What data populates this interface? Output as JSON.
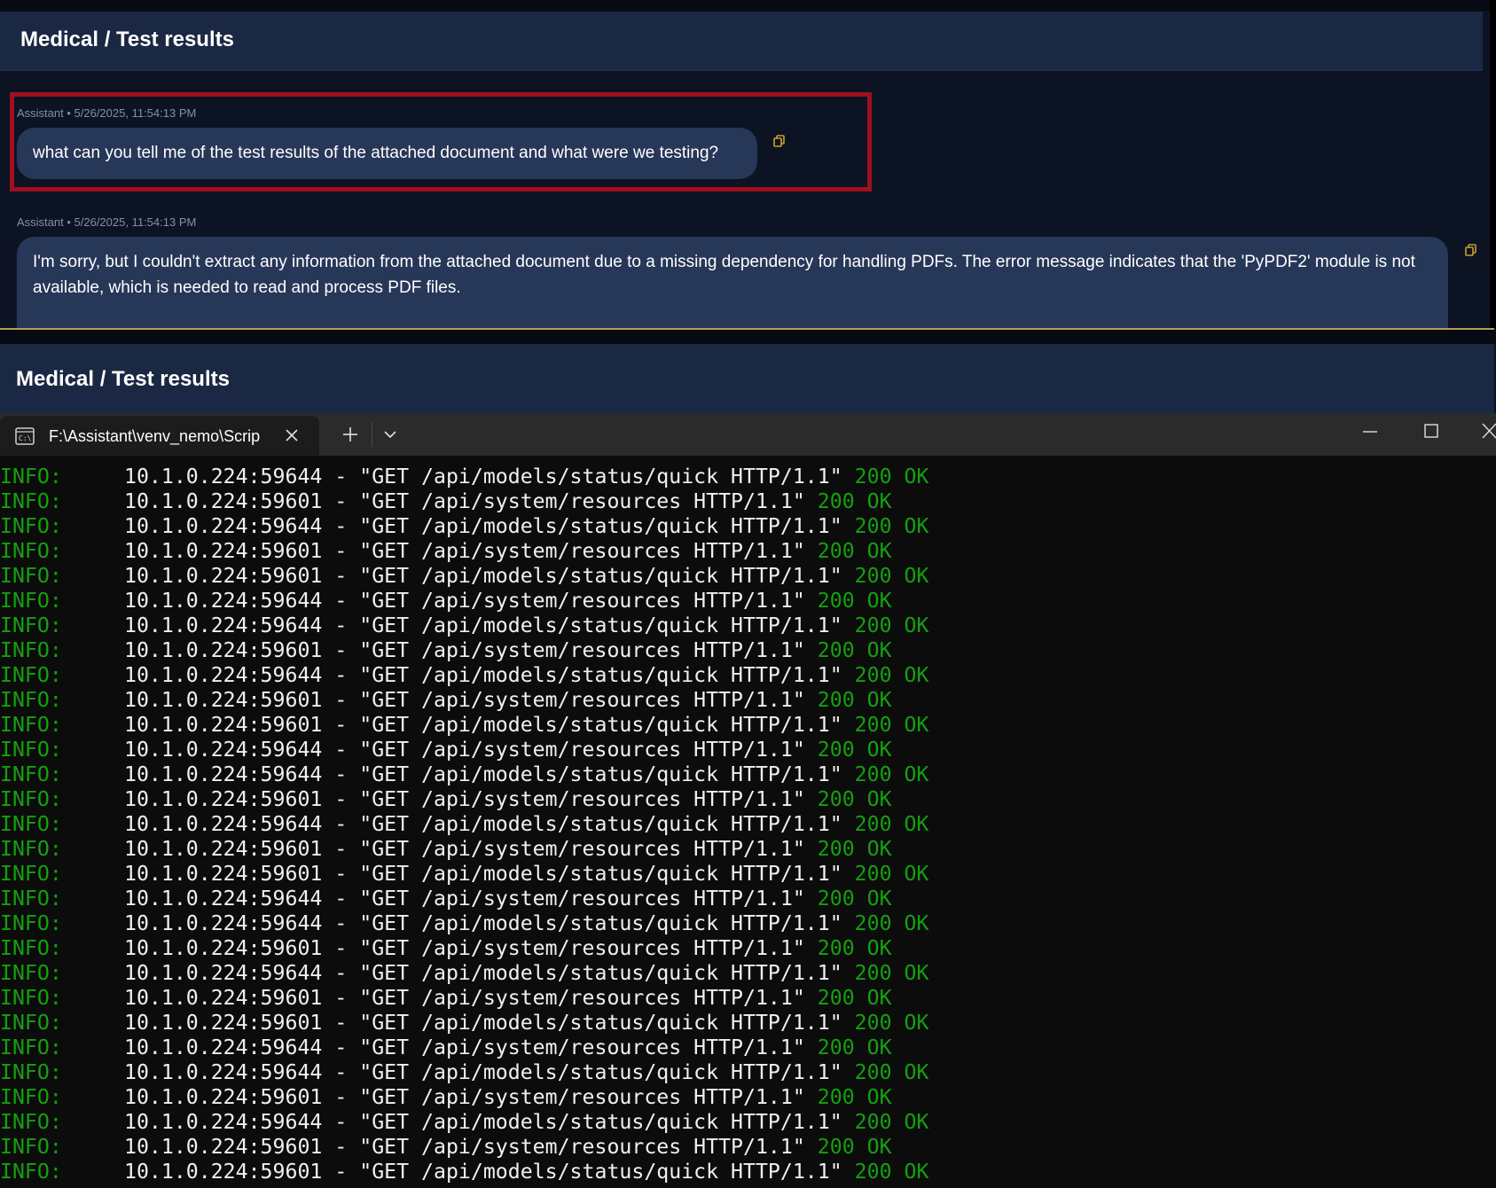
{
  "chat_top": {
    "header_title": "Medical / Test results",
    "messages": [
      {
        "meta": "Assistant • 5/26/2025, 11:54:13 PM",
        "text": "what can you tell me of the test results of the attached document and what were we testing?"
      },
      {
        "meta": "Assistant • 5/26/2025, 11:54:13 PM",
        "text": "I'm sorry, but I couldn't extract any information from the attached document due to a missing dependency for handling PDFs. The error message indicates that the 'PyPDF2' module is not available, which is needed to read and process PDF files."
      }
    ]
  },
  "chat_bottom": {
    "header_title": "Medical / Test results"
  },
  "terminal": {
    "tab_title": "F:\\Assistant\\venv_nemo\\Scrip",
    "icons": {
      "tab": "terminal-icon",
      "close": "close-icon",
      "new_tab": "plus-icon",
      "dropdown": "chevron-down-icon",
      "minimize": "minimize-icon",
      "maximize": "maximize-icon",
      "window_close": "close-icon"
    },
    "log_lines": [
      {
        "level": "INFO:",
        "text": "10.1.0.224:59644 - \"GET /api/models/status/quick HTTP/1.1\"",
        "status": "200 OK"
      },
      {
        "level": "INFO:",
        "text": "10.1.0.224:59601 - \"GET /api/system/resources HTTP/1.1\"",
        "status": "200 OK"
      },
      {
        "level": "INFO:",
        "text": "10.1.0.224:59644 - \"GET /api/models/status/quick HTTP/1.1\"",
        "status": "200 OK"
      },
      {
        "level": "INFO:",
        "text": "10.1.0.224:59601 - \"GET /api/system/resources HTTP/1.1\"",
        "status": "200 OK"
      },
      {
        "level": "INFO:",
        "text": "10.1.0.224:59601 - \"GET /api/models/status/quick HTTP/1.1\"",
        "status": "200 OK"
      },
      {
        "level": "INFO:",
        "text": "10.1.0.224:59644 - \"GET /api/system/resources HTTP/1.1\"",
        "status": "200 OK"
      },
      {
        "level": "INFO:",
        "text": "10.1.0.224:59644 - \"GET /api/models/status/quick HTTP/1.1\"",
        "status": "200 OK"
      },
      {
        "level": "INFO:",
        "text": "10.1.0.224:59601 - \"GET /api/system/resources HTTP/1.1\"",
        "status": "200 OK"
      },
      {
        "level": "INFO:",
        "text": "10.1.0.224:59644 - \"GET /api/models/status/quick HTTP/1.1\"",
        "status": "200 OK"
      },
      {
        "level": "INFO:",
        "text": "10.1.0.224:59601 - \"GET /api/system/resources HTTP/1.1\"",
        "status": "200 OK"
      },
      {
        "level": "INFO:",
        "text": "10.1.0.224:59601 - \"GET /api/models/status/quick HTTP/1.1\"",
        "status": "200 OK"
      },
      {
        "level": "INFO:",
        "text": "10.1.0.224:59644 - \"GET /api/system/resources HTTP/1.1\"",
        "status": "200 OK"
      },
      {
        "level": "INFO:",
        "text": "10.1.0.224:59644 - \"GET /api/models/status/quick HTTP/1.1\"",
        "status": "200 OK"
      },
      {
        "level": "INFO:",
        "text": "10.1.0.224:59601 - \"GET /api/system/resources HTTP/1.1\"",
        "status": "200 OK"
      },
      {
        "level": "INFO:",
        "text": "10.1.0.224:59644 - \"GET /api/models/status/quick HTTP/1.1\"",
        "status": "200 OK"
      },
      {
        "level": "INFO:",
        "text": "10.1.0.224:59601 - \"GET /api/system/resources HTTP/1.1\"",
        "status": "200 OK"
      },
      {
        "level": "INFO:",
        "text": "10.1.0.224:59601 - \"GET /api/models/status/quick HTTP/1.1\"",
        "status": "200 OK"
      },
      {
        "level": "INFO:",
        "text": "10.1.0.224:59644 - \"GET /api/system/resources HTTP/1.1\"",
        "status": "200 OK"
      },
      {
        "level": "INFO:",
        "text": "10.1.0.224:59644 - \"GET /api/models/status/quick HTTP/1.1\"",
        "status": "200 OK"
      },
      {
        "level": "INFO:",
        "text": "10.1.0.224:59601 - \"GET /api/system/resources HTTP/1.1\"",
        "status": "200 OK"
      },
      {
        "level": "INFO:",
        "text": "10.1.0.224:59644 - \"GET /api/models/status/quick HTTP/1.1\"",
        "status": "200 OK"
      },
      {
        "level": "INFO:",
        "text": "10.1.0.224:59601 - \"GET /api/system/resources HTTP/1.1\"",
        "status": "200 OK"
      },
      {
        "level": "INFO:",
        "text": "10.1.0.224:59601 - \"GET /api/models/status/quick HTTP/1.1\"",
        "status": "200 OK"
      },
      {
        "level": "INFO:",
        "text": "10.1.0.224:59644 - \"GET /api/system/resources HTTP/1.1\"",
        "status": "200 OK"
      },
      {
        "level": "INFO:",
        "text": "10.1.0.224:59644 - \"GET /api/models/status/quick HTTP/1.1\"",
        "status": "200 OK"
      },
      {
        "level": "INFO:",
        "text": "10.1.0.224:59601 - \"GET /api/system/resources HTTP/1.1\"",
        "status": "200 OK"
      },
      {
        "level": "INFO:",
        "text": "10.1.0.224:59644 - \"GET /api/models/status/quick HTTP/1.1\"",
        "status": "200 OK"
      },
      {
        "level": "INFO:",
        "text": "10.1.0.224:59601 - \"GET /api/system/resources HTTP/1.1\"",
        "status": "200 OK"
      },
      {
        "level": "INFO:",
        "text": "10.1.0.224:59601 - \"GET /api/models/status/quick HTTP/1.1\"",
        "status": "200 OK"
      }
    ]
  },
  "colors": {
    "highlight_border": "#a10f1f",
    "bubble_bg": "#273758",
    "header_bg": "#1b2843",
    "terminal_green": "#13a10e",
    "copy_icon": "#c9a227"
  }
}
